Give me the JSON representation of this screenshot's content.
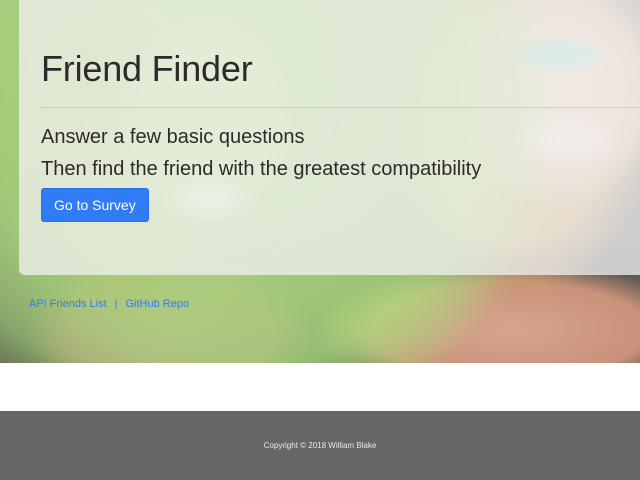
{
  "hero": {
    "title": "Friend Finder",
    "lead_line_1": "Answer a few basic questions",
    "lead_line_2": "Then find the friend with the greatest compatibility",
    "cta_label": "Go to Survey"
  },
  "links": [
    {
      "label": "API Friends List"
    },
    {
      "label": "GitHub Repo"
    }
  ],
  "footer": {
    "text": "Copyright © 2018 William Blake"
  },
  "colors": {
    "primary": "#2f7cf6",
    "footer_bg": "#666666",
    "jumbotron_bg": "rgba(240,240,240,0.76)"
  }
}
